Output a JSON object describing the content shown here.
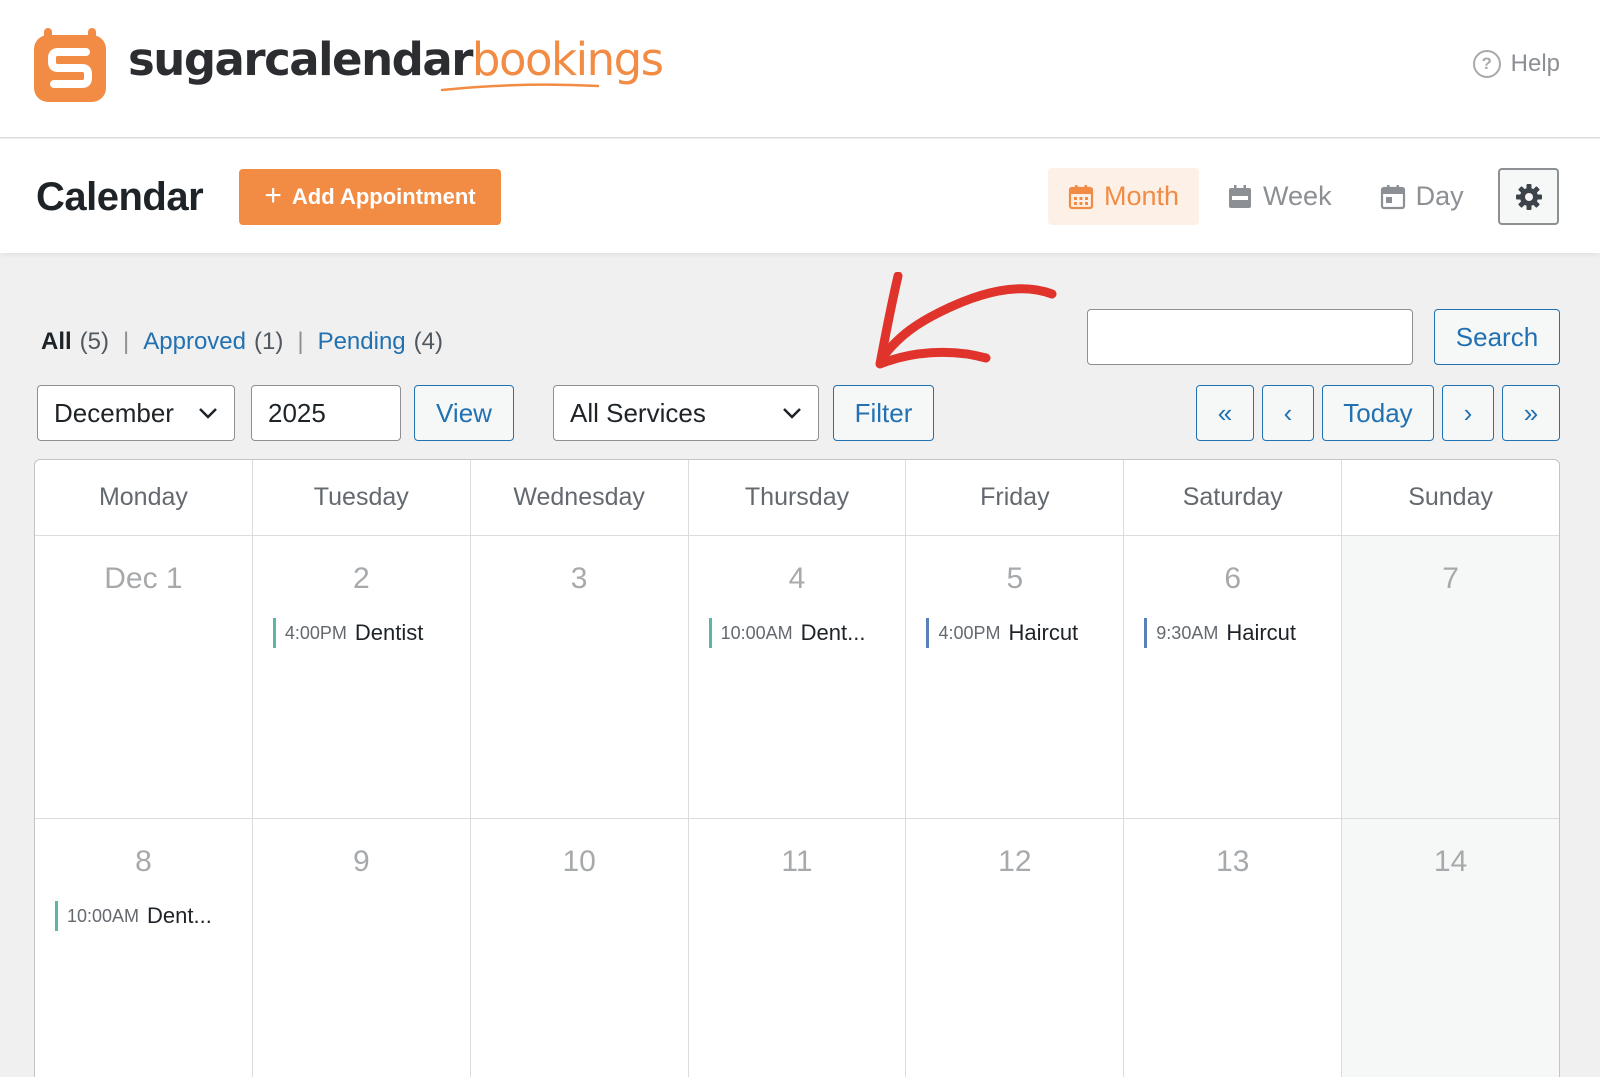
{
  "brand": {
    "name_part1": "sugarcalendar",
    "name_part2": "bookings",
    "help_label": "Help"
  },
  "header": {
    "title": "Calendar",
    "add_button": "Add Appointment",
    "views": [
      {
        "label": "Month",
        "active": true
      },
      {
        "label": "Week",
        "active": false
      },
      {
        "label": "Day",
        "active": false
      }
    ]
  },
  "status_filter": {
    "all_label": "All",
    "all_count": "(5)",
    "approved_label": "Approved",
    "approved_count": "(1)",
    "pending_label": "Pending",
    "pending_count": "(4)",
    "separator": "|"
  },
  "search": {
    "value": "",
    "button": "Search"
  },
  "controls": {
    "month": "December",
    "year": "2025",
    "view_button": "View",
    "service": "All Services",
    "filter_button": "Filter",
    "nav_first": "«",
    "nav_prev": "‹",
    "nav_today": "Today",
    "nav_next": "›",
    "nav_last": "»"
  },
  "calendar": {
    "weekdays": [
      "Monday",
      "Tuesday",
      "Wednesday",
      "Thursday",
      "Friday",
      "Saturday",
      "Sunday"
    ],
    "weeks": [
      [
        {
          "label": "Dec 1"
        },
        {
          "label": "2",
          "appt": {
            "time": "4:00PM",
            "name": "Dentist",
            "status": "approved"
          }
        },
        {
          "label": "3"
        },
        {
          "label": "4",
          "appt": {
            "time": "10:00AM",
            "name": "Dent...",
            "status": "approved"
          }
        },
        {
          "label": "5",
          "appt": {
            "time": "4:00PM",
            "name": "Haircut",
            "status": "pending"
          }
        },
        {
          "label": "6",
          "appt": {
            "time": "9:30AM",
            "name": "Haircut",
            "status": "pending"
          }
        },
        {
          "label": "7"
        }
      ],
      [
        {
          "label": "8",
          "appt": {
            "time": "10:00AM",
            "name": "Dent...",
            "status": "approved"
          }
        },
        {
          "label": "9"
        },
        {
          "label": "10"
        },
        {
          "label": "11"
        },
        {
          "label": "12"
        },
        {
          "label": "13"
        },
        {
          "label": "14"
        }
      ]
    ]
  },
  "colors": {
    "brand_orange": "#f28c45",
    "link_blue": "#2271b1",
    "approved_bar": "#5bb7a5",
    "pending_bar": "#5b7fb7",
    "annotation_red": "#e0332b"
  },
  "icons": {
    "logo": "sugarcalendar-logo-icon",
    "help": "question-circle-icon",
    "month": "calendar-month-icon",
    "week": "calendar-week-icon",
    "day": "calendar-day-icon",
    "settings": "gear-icon",
    "dropdown": "chevron-down-icon",
    "annotation": "red-arrow-icon"
  }
}
